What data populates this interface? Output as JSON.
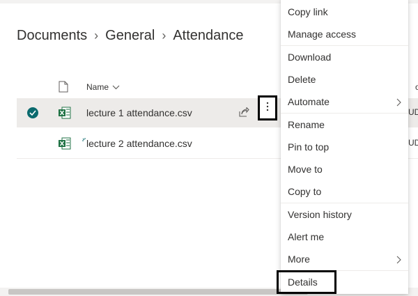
{
  "breadcrumb": {
    "items": [
      "Documents",
      "General",
      "Attendance"
    ]
  },
  "list": {
    "columns": {
      "name": "Name",
      "modified_partial": "od"
    },
    "rows": [
      {
        "name": "lecture 1 attendance.csv",
        "modified_partial": "UD",
        "selected": true
      },
      {
        "name": "lecture 2 attendance.csv",
        "modified_partial": "UD",
        "selected": false
      }
    ]
  },
  "context_menu": {
    "items": [
      "Copy link",
      "Manage access",
      "Download",
      "Delete",
      "Automate",
      "Rename",
      "Pin to top",
      "Move to",
      "Copy to",
      "Version history",
      "Alert me",
      "More",
      "Details"
    ]
  },
  "colors": {
    "accent": "#0b6a6e",
    "excel_green": "#1f7244",
    "selected_row": "#edebe9"
  },
  "icons": [
    "file-icon",
    "chevron-down-icon",
    "check-icon",
    "excel-icon",
    "share-icon",
    "more-icon",
    "chevron-right-icon",
    "new-sparkle-icon"
  ]
}
